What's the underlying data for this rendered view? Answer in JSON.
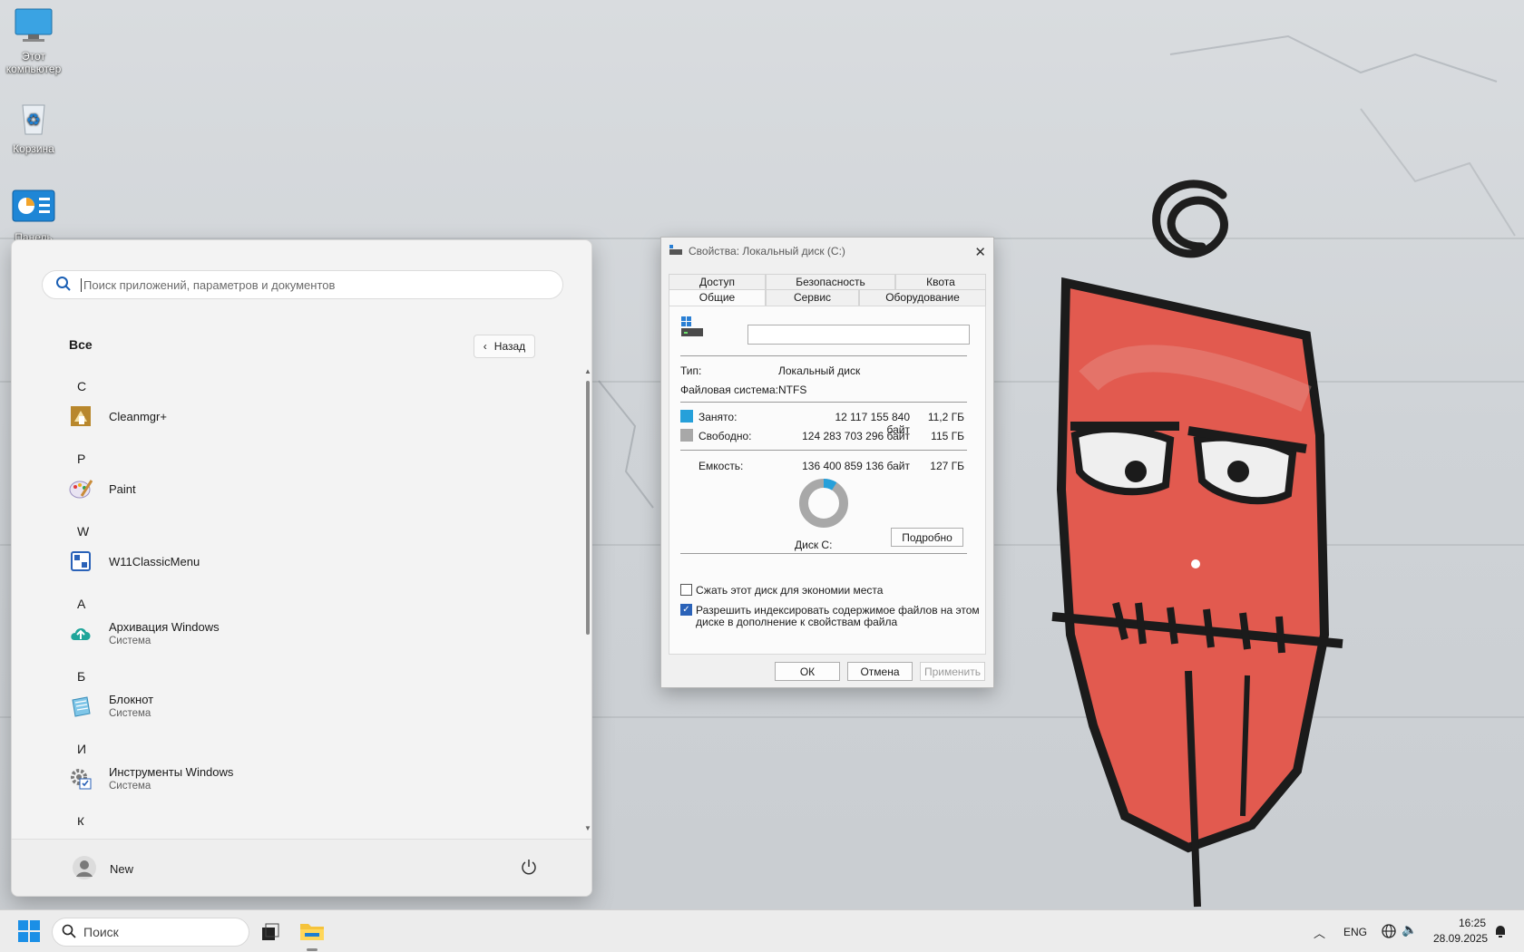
{
  "desktop": {
    "icons": [
      {
        "label": "Этот компьютер"
      },
      {
        "label": "Корзина"
      },
      {
        "label": "Панель"
      }
    ]
  },
  "start_menu": {
    "search_placeholder": "Поиск приложений, параметров и документов",
    "all_label": "Все",
    "back_label": "Назад",
    "sections": [
      {
        "letter": "C"
      },
      {
        "letter": "P"
      },
      {
        "letter": "W"
      },
      {
        "letter": "А"
      },
      {
        "letter": "Б"
      },
      {
        "letter": "И"
      },
      {
        "letter": "К"
      }
    ],
    "apps": [
      {
        "name": "Cleanmgr+",
        "subtitle": ""
      },
      {
        "name": "Paint",
        "subtitle": ""
      },
      {
        "name": "W11ClassicMenu",
        "subtitle": ""
      },
      {
        "name": "Архивация Windows",
        "subtitle": "Система"
      },
      {
        "name": "Блокнот",
        "subtitle": "Система"
      },
      {
        "name": "Инструменты Windows",
        "subtitle": "Система"
      }
    ],
    "user_name": "New"
  },
  "dialog": {
    "title": "Свойства: Локальный диск (C:)",
    "tabs_top": [
      "Доступ",
      "Безопасность",
      "Квота"
    ],
    "tabs_bottom": [
      "Общие",
      "Сервис",
      "Оборудование"
    ],
    "active_tab": "Общие",
    "name_value": "",
    "type_label": "Тип:",
    "type_value": "Локальный диск",
    "fs_label": "Файловая система:",
    "fs_value": "NTFS",
    "used_label": "Занято:",
    "used_bytes": "12 117 155 840 байт",
    "used_human": "11,2 ГБ",
    "free_label": "Свободно:",
    "free_bytes": "124 283 703 296 байт",
    "free_human": "115 ГБ",
    "capacity_label": "Емкость:",
    "capacity_bytes": "136 400 859 136 байт",
    "capacity_human": "127 ГБ",
    "disk_label": "Диск C:",
    "details_button": "Подробно",
    "compress_label": "Сжать этот диск для экономии места",
    "compress_checked": false,
    "index_label_1": "Разрешить индексировать содержимое файлов на этом",
    "index_label_2": "диске в дополнение к свойствам файла",
    "index_checked": true,
    "ok_label": "ОК",
    "cancel_label": "Отмена",
    "apply_label": "Применить",
    "used_fraction": 0.089,
    "colors": {
      "used": "#26a0da",
      "free": "#a8a8a8"
    }
  },
  "taskbar": {
    "search_label": "Поиск",
    "lang": "ENG",
    "time": "16:25",
    "date": "28.09.2025"
  }
}
